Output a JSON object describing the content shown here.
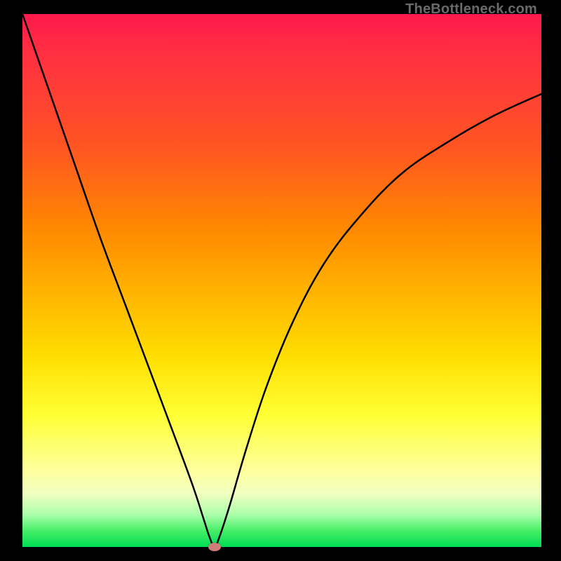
{
  "watermark": "TheBottleneck.com",
  "chart_data": {
    "type": "line",
    "title": "",
    "xlabel": "",
    "ylabel": "",
    "xlim": [
      0,
      100
    ],
    "ylim": [
      0,
      100
    ],
    "grid": false,
    "legend": false,
    "optimum": {
      "x": 37,
      "y": 0
    },
    "series": [
      {
        "name": "bottleneck-curve",
        "x": [
          0,
          5,
          10,
          15,
          20,
          25,
          30,
          33,
          35,
          36,
          37,
          38,
          40,
          43,
          47,
          52,
          58,
          65,
          73,
          82,
          91,
          100
        ],
        "values": [
          100,
          86,
          72,
          58,
          45,
          32,
          19,
          11,
          5,
          2,
          0,
          2,
          8,
          18,
          30,
          42,
          53,
          62,
          70,
          76,
          81,
          85
        ]
      }
    ],
    "gradient_meaning": "vertical gradient: red (top, high bottleneck) to green (bottom, no bottleneck)",
    "colors": {
      "curve": "#000000",
      "dot": "#cf7d77",
      "gradient_top": "#ff1a4d",
      "gradient_bottom": "#00dd55",
      "frame": "#000000"
    }
  }
}
